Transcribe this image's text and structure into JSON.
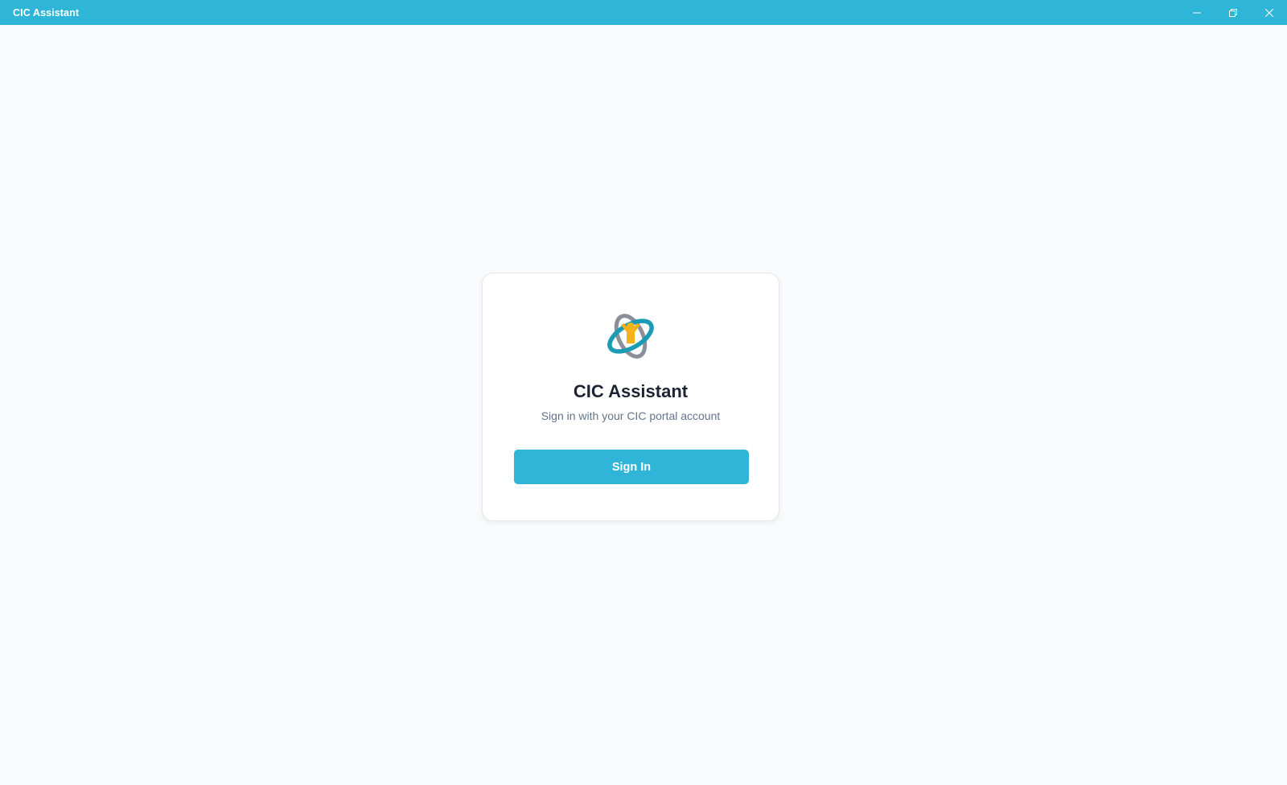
{
  "window": {
    "title": "CIC Assistant",
    "controls": {
      "minimize_icon": "minimize-icon",
      "restore_icon": "restore-icon",
      "close_icon": "close-icon"
    }
  },
  "login_card": {
    "logo_icon": "cic-logo",
    "title": "CIC Assistant",
    "subtitle": "Sign in with your CIC portal account",
    "sign_in_label": "Sign In"
  },
  "colors": {
    "accent": "#2fb5d7",
    "background": "#f8fafc",
    "card": "#ffffff",
    "title_text": "#1e2433",
    "subtitle_text": "#64748b",
    "logo_teal": "#1b9bb5",
    "logo_gray": "#8a8f98",
    "logo_yellow": "#f5b21b"
  }
}
